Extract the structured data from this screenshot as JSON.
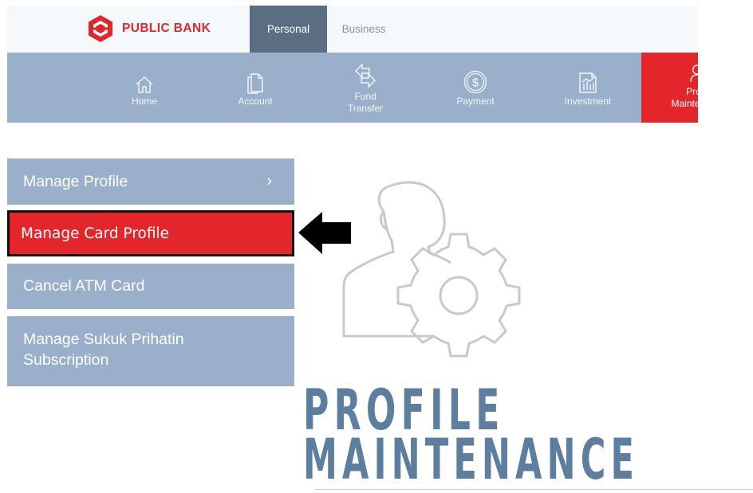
{
  "brand": {
    "name": "PUBLIC BANK",
    "color": "#e3262b"
  },
  "top_tabs": [
    {
      "label": "Personal",
      "selected": true
    },
    {
      "label": "Business",
      "selected": false
    }
  ],
  "nav": [
    {
      "label": "Home",
      "icon": "home-icon"
    },
    {
      "label": "Account",
      "icon": "document-icon"
    },
    {
      "label": "Fund Transfer",
      "label_lines": [
        "Fund",
        "Transfer"
      ],
      "icon": "transfer-arrows-icon"
    },
    {
      "label": "Payment",
      "icon": "dollar-coin-icon"
    },
    {
      "label": "Investment",
      "icon": "chart-icon"
    },
    {
      "label": "Profile Maintenance",
      "label_lines": [
        "Pro",
        "Mainte"
      ],
      "icon": "profile-icon",
      "active": true
    }
  ],
  "side_menu": [
    {
      "label": "Manage Profile",
      "chevron": "›"
    },
    {
      "label": "Manage Card Profile",
      "active": true
    },
    {
      "label": "Cancel ATM Card"
    },
    {
      "label": "Manage Sukuk Prihatin Subscription",
      "label_lines": [
        "Manage Sukuk Prihatin",
        "Subscription"
      ]
    }
  ],
  "hero": {
    "title_line1": "PROFILE",
    "title_line2": "MAINTENANCE",
    "icon": "user-gear-icon"
  },
  "colors": {
    "nav_bg": "#9ab0ca",
    "active_red": "#e3262b",
    "tab_dark": "#5b6e81",
    "hero_text": "#5d7e9f"
  }
}
